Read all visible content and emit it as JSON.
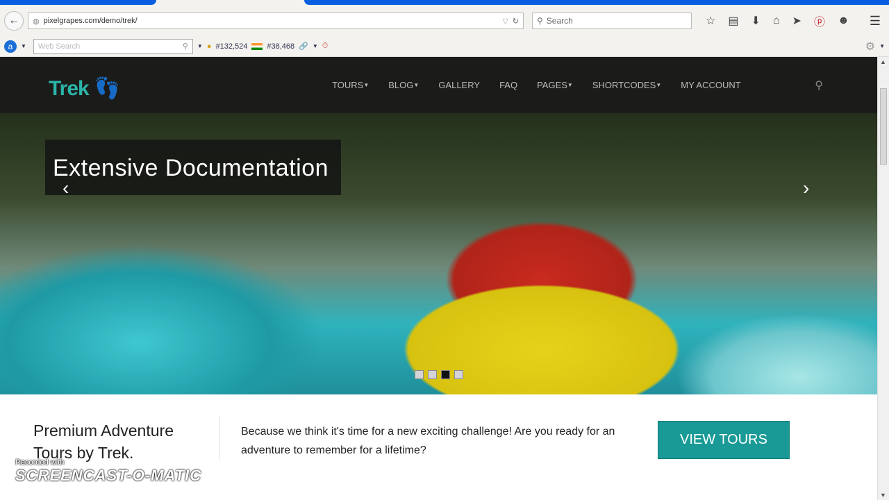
{
  "browser": {
    "url": "pixelgrapes.com/demo/trek/",
    "search_placeholder": "Search",
    "toolbar_icons": [
      "star-icon",
      "clipboard-icon",
      "download-icon",
      "home-icon",
      "send-icon",
      "pinterest-icon",
      "chat-icon"
    ]
  },
  "addon_bar": {
    "web_search_placeholder": "Web Search",
    "global_rank": "#132,524",
    "country_rank": "#38,468"
  },
  "site": {
    "logo": "Trek",
    "nav": [
      {
        "label": "TOURS",
        "dropdown": true
      },
      {
        "label": "BLOG",
        "dropdown": true
      },
      {
        "label": "GALLERY",
        "dropdown": false
      },
      {
        "label": "FAQ",
        "dropdown": false
      },
      {
        "label": "PAGES",
        "dropdown": true
      },
      {
        "label": "SHORTCODES",
        "dropdown": true
      },
      {
        "label": "MY ACCOUNT",
        "dropdown": false
      }
    ],
    "slider": {
      "caption": "Extensive Documentation",
      "slide_count": 4,
      "active_slide": 3
    },
    "intro": {
      "heading": "Premium Adventure Tours by Trek.",
      "text": "Because we think it's time for a new exciting challenge! Are you ready for an adventure to remember for a lifetime?",
      "button": "VIEW TOURS"
    }
  },
  "watermark": {
    "line1": "Recorded with",
    "line2": "SCREENCAST-O-MATIC"
  },
  "colors": {
    "accent": "#1a9a96",
    "header_bg": "#1b1c1a"
  }
}
